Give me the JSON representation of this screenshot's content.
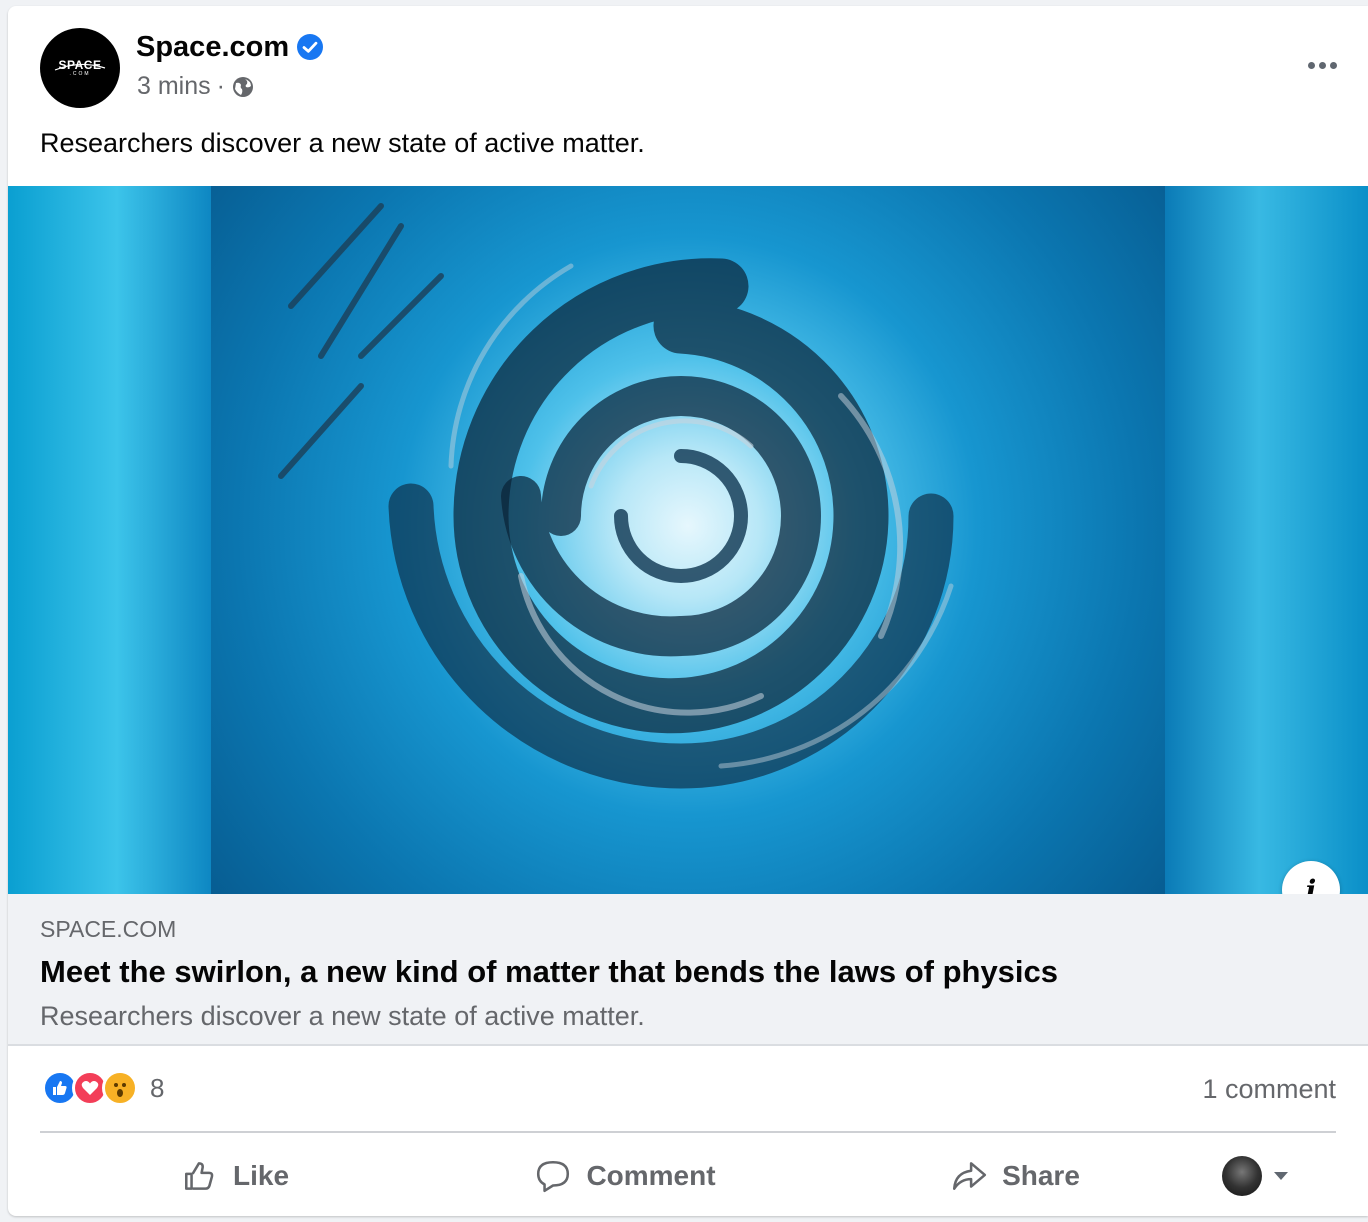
{
  "post": {
    "page_name": "Space.com",
    "time": "3 mins",
    "separator": "·",
    "text": "Researchers discover a new state of active matter.",
    "avatar_logo": "SPACE",
    "avatar_sub": ".COM"
  },
  "link_preview": {
    "domain": "SPACE.COM",
    "title": "Meet the swirlon, a new kind of matter that bends the laws of physics",
    "description": "Researchers discover a new state of active matter.",
    "info_icon": "i"
  },
  "engagement": {
    "reaction_count": "8",
    "comment_count": "1 comment"
  },
  "actions": {
    "like": "Like",
    "comment": "Comment",
    "share": "Share"
  },
  "icons": {
    "verified": "verified-badge-icon",
    "audience": "globe-icon",
    "more": "more-options-icon",
    "like": "thumbs-up-icon",
    "comment": "speech-bubble-icon",
    "share": "share-arrow-icon"
  },
  "colors": {
    "brand": "#1877f2",
    "love": "#f33e58",
    "wow": "#f7b125",
    "secondary_text": "#65676b"
  }
}
